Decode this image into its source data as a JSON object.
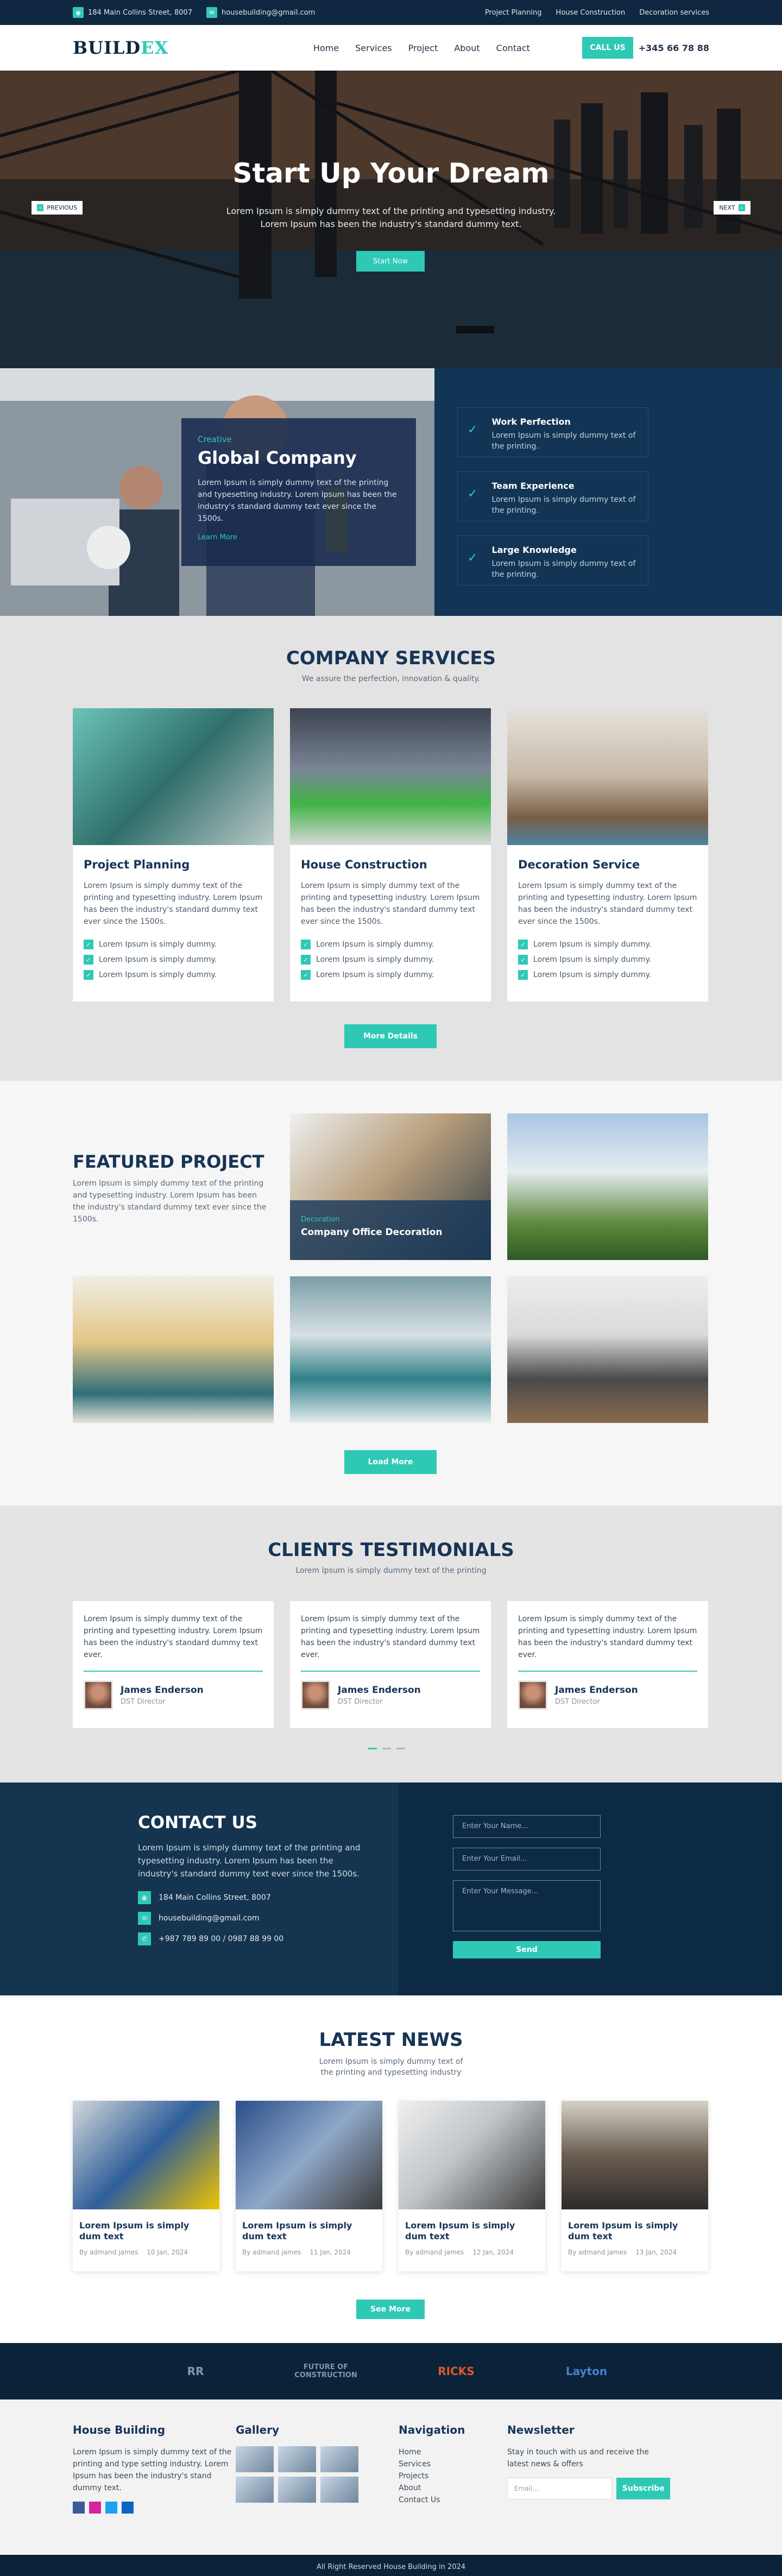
{
  "topbar": {
    "address": "184 Main Collins Street, 8007",
    "email": "housebuilding@gmail.com",
    "links": [
      "Project Planning",
      "House Construction",
      "Decoration services"
    ]
  },
  "nav": {
    "logo_main": "BUILD",
    "logo_accent": "EX",
    "items": [
      "Home",
      "Services",
      "Project",
      "About",
      "Contact"
    ],
    "call_label": "CALL US",
    "phone": "+345 66 78 88"
  },
  "hero": {
    "title": "Start Up Your Dream",
    "text": "Lorem Ipsum is simply dummy text of the printing and typesetting industry. Lorem Ipsum has been the industry's standard dummy text.",
    "button": "Start Now",
    "prev": "PREVIOUS",
    "next": "NEXT"
  },
  "about": {
    "kicker": "Creative",
    "title": "Global Company",
    "text": "Lorem Ipsum is simply dummy text of the printing and typesetting industry. Lorem Ipsum has been the industry's standard dummy text ever since the 1500s.",
    "more": "Learn More",
    "features": [
      {
        "title": "Work Perfection",
        "text": "Lorem Ipsum is simply dummy text of the printing."
      },
      {
        "title": "Team Experience",
        "text": "Lorem Ipsum is simply dummy text of the printing."
      },
      {
        "title": "Large Knowledge",
        "text": "Lorem Ipsum is simply dummy text of the printing."
      }
    ]
  },
  "services": {
    "title": "COMPANY SERVICES",
    "subtitle": "We assure the perfection, innovation & quality.",
    "cards": [
      {
        "title": "Project Planning",
        "text": "Lorem Ipsum is simply dummy text of the printing and typesetting industry. Lorem Ipsum has been the industry's standard dummy text ever since the 1500s.",
        "bullets": [
          "Lorem Ipsum is simply dummy.",
          "Lorem Ipsum is simply dummy.",
          "Lorem Ipsum is simply dummy."
        ]
      },
      {
        "title": "House Construction",
        "text": "Lorem Ipsum is simply dummy text of the printing and typesetting industry. Lorem Ipsum has been the industry's standard dummy text ever since the 1500s.",
        "bullets": [
          "Lorem Ipsum is simply dummy.",
          "Lorem Ipsum is simply dummy.",
          "Lorem Ipsum is simply dummy."
        ]
      },
      {
        "title": "Decoration Service",
        "text": "Lorem Ipsum is simply dummy text of the printing and typesetting industry. Lorem Ipsum has been the industry's standard dummy text ever since the 1500s.",
        "bullets": [
          "Lorem Ipsum is simply dummy.",
          "Lorem Ipsum is simply dummy.",
          "Lorem Ipsum is simply dummy."
        ]
      }
    ],
    "button": "More Details"
  },
  "projects": {
    "title": "FEATURED PROJECT",
    "intro": "Lorem Ipsum is simply dummy text of the printing and typesetting industry. Lorem Ipsum has been the industry's standard dummy text ever since the 1500s.",
    "overlay_kicker": "Decoration",
    "overlay_title": "Company Office Decoration",
    "button": "Load More"
  },
  "testimonials": {
    "title": "CLIENTS TESTIMONIALS",
    "subtitle": "Lorem Ipsum is simply dummy text of the printing",
    "items": [
      {
        "text": "Lorem Ipsum is simply dummy text of the printing and typesetting industry. Lorem Ipsum has been the industry's standard dummy text ever.",
        "name": "James Enderson",
        "role": "DST Director"
      },
      {
        "text": "Lorem Ipsum is simply dummy text of the printing and typesetting industry. Lorem Ipsum has been the industry's standard dummy text ever.",
        "name": "James Enderson",
        "role": "DST Director"
      },
      {
        "text": "Lorem Ipsum is simply dummy text of the printing and typesetting industry. Lorem Ipsum has been the industry's standard dummy text ever.",
        "name": "James Enderson",
        "role": "DST Director"
      }
    ]
  },
  "contact": {
    "title": "CONTACT US",
    "text": "Lorem Ipsum is simply dummy text of the printing and typesetting industry. Lorem Ipsum has been the industry's standard dummy text ever since the 1500s.",
    "address": "184 Main Collins Street, 8007",
    "email": "housebuilding@gmail.com",
    "phones": "+987 789 89 00 / 0987 88 99 00",
    "name_placeholder": "Enter Your Name...",
    "email_placeholder": "Enter Your Email...",
    "message_placeholder": "Enter Your Message...",
    "send": "Send"
  },
  "news": {
    "title": "LATEST NEWS",
    "subtitle": "Lorem Ipsum is simply dummy text of the printing and typesetting industry",
    "items": [
      {
        "title": "Lorem Ipsum is simply dum text",
        "author": "By admand james",
        "date": "10 Jan, 2024"
      },
      {
        "title": "Lorem Ipsum is simply dum text",
        "author": "By admand james",
        "date": "11 Jan, 2024"
      },
      {
        "title": "Lorem Ipsum is simply dum text",
        "author": "By admand james",
        "date": "12 Jan, 2024"
      },
      {
        "title": "Lorem Ipsum is simply dum text",
        "author": "By admand james",
        "date": "13 Jan, 2024"
      }
    ],
    "button": "See More"
  },
  "partners": [
    "RR",
    "FUTURE OF CONSTRUCTION",
    "RICKS",
    "Layton"
  ],
  "footer": {
    "col1_title": "House Building",
    "col1_text": "Lorem Ipsum is simply dummy text of the printing and type setting industry. Lorem Ipsum has been the industry's stand dummy text.",
    "col2_title": "Gallery",
    "col3_title": "Navigation",
    "nav": [
      "Home",
      "Services",
      "Projects",
      "About",
      "Contact Us"
    ],
    "col4_title": "Newsletter",
    "col4_text": "Stay in touch with us and receive the latest news & offers",
    "email_placeholder": "Email...",
    "subscribe": "Subscribe",
    "copyright": "All Right Reserved House Building in 2024"
  },
  "colors": {
    "accent": "#2ec9b5",
    "navy": "#0f2740"
  }
}
